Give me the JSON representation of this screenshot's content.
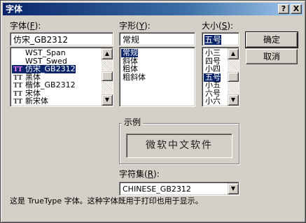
{
  "window": {
    "title": "字体"
  },
  "titlebar": {
    "help_label": "?",
    "close_label": "X"
  },
  "font": {
    "label_prefix": "字体(",
    "label_key": "F",
    "label_suffix": "):",
    "value": "仿宋_GB2312",
    "items": [
      {
        "name": "WST_Span",
        "icon": "",
        "selected": false
      },
      {
        "name": "WST_Swed",
        "icon": "",
        "selected": false
      },
      {
        "name": "仿宋_GB2312",
        "icon": "truetype-icon",
        "selected": true
      },
      {
        "name": "黑体",
        "icon": "truetype-icon",
        "selected": false
      },
      {
        "name": "楷体_GB2312",
        "icon": "truetype-icon",
        "selected": false
      },
      {
        "name": "宋体",
        "icon": "truetype-icon",
        "selected": false
      },
      {
        "name": "新宋体",
        "icon": "truetype-icon",
        "selected": false
      }
    ]
  },
  "style": {
    "label_prefix": "字形(",
    "label_key": "Y",
    "label_suffix": "):",
    "value": "常规",
    "items": [
      {
        "name": "常规",
        "selected": true
      },
      {
        "name": "斜体",
        "selected": false
      },
      {
        "name": "粗体",
        "selected": false
      },
      {
        "name": "粗斜体",
        "selected": false
      }
    ]
  },
  "size": {
    "label_prefix": "大小(",
    "label_key": "S",
    "label_suffix": "):",
    "value": "五号",
    "items": [
      {
        "name": "小三",
        "selected": false
      },
      {
        "name": "四号",
        "selected": false
      },
      {
        "name": "小四",
        "selected": false
      },
      {
        "name": "五号",
        "selected": true
      },
      {
        "name": "小五",
        "selected": false
      },
      {
        "name": "六号",
        "selected": false
      },
      {
        "name": "小六",
        "selected": false
      }
    ]
  },
  "buttons": {
    "ok": "确定",
    "cancel": "取消"
  },
  "sample": {
    "legend": "示例",
    "text": "微软中文软件"
  },
  "charset": {
    "label_prefix": "字符集(",
    "label_key": "R",
    "label_suffix": "):",
    "value": "CHINESE_GB2312"
  },
  "footer": {
    "text": "这是 TrueType 字体。这种字体既用于打印也用于显示。"
  },
  "glyphs": {
    "tt": "TT",
    "up": "▲",
    "down": "▼"
  }
}
